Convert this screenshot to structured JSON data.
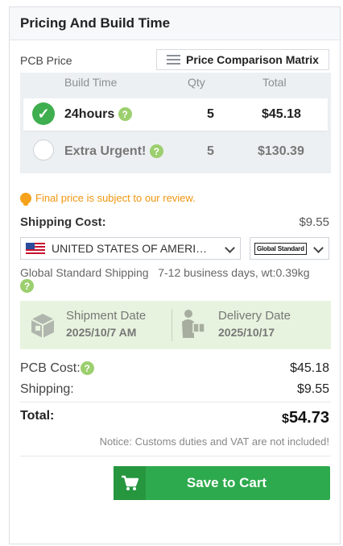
{
  "panel": {
    "title": "Pricing And Build Time"
  },
  "pcb_price": {
    "label": "PCB Price",
    "matrix_button": "Price Comparison Matrix",
    "columns": [
      "Build Time",
      "Qty",
      "Total"
    ],
    "rows": [
      {
        "build_time": "24hours",
        "qty": "5",
        "total": "$45.18",
        "selected": true
      },
      {
        "build_time": "Extra Urgent!",
        "qty": "5",
        "total": "$130.39",
        "selected": false
      }
    ]
  },
  "review_notice": "Final price is subject to our review.",
  "shipping": {
    "label": "Shipping Cost:",
    "value": "$9.55",
    "country": "UNITED STATES OF AMERI…",
    "method_logo": "Global Standard",
    "info_method": "Global Standard Shipping",
    "info_detail": "7-12 business days, wt:0.39kg"
  },
  "dates": {
    "shipment_label": "Shipment Date",
    "shipment_value": "2025/10/7 AM",
    "delivery_label": "Delivery Date",
    "delivery_value": "2025/10/17"
  },
  "summary": {
    "pcb_cost_label": "PCB Cost:",
    "pcb_cost_value": "$45.18",
    "shipping_label": "Shipping:",
    "shipping_value": "$9.55",
    "total_label": "Total:",
    "total_currency": "$",
    "total_value": "54.73",
    "customs_notice": "Notice: Customs duties and VAT are not included!"
  },
  "cart": {
    "button_label": "Save to Cart"
  },
  "colors": {
    "accent_green": "#2eaa4e",
    "warning_orange": "#f0960f",
    "date_panel": "#e7f3de"
  },
  "icons": [
    "question-icon",
    "check-icon",
    "bulb-icon",
    "us-flag-icon",
    "chevron-down-icon",
    "list-icon",
    "package-icon",
    "delivery-person-icon",
    "cart-icon"
  ]
}
